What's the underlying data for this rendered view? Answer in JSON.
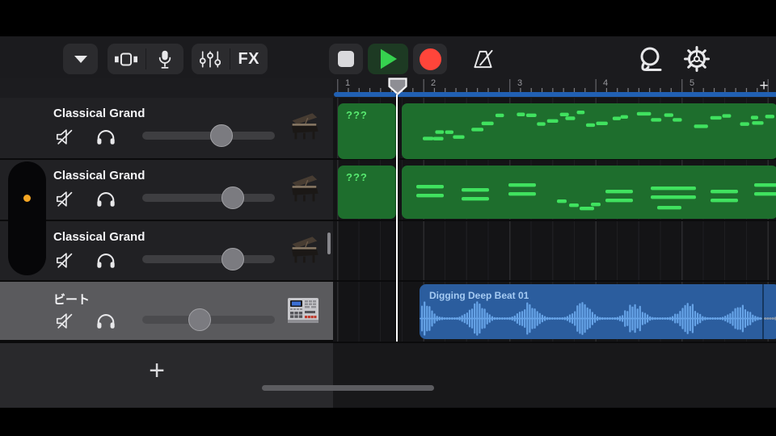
{
  "toolbar": {
    "fx_label": "FX"
  },
  "ruler": {
    "bars": [
      "1",
      "2",
      "3",
      "4",
      "5"
    ],
    "add_section_label": "+"
  },
  "tracks": [
    {
      "name": "Classical Grand",
      "instrument_icon": "grand-piano",
      "volume_percent": 60,
      "selected": false
    },
    {
      "name": "Classical Grand",
      "instrument_icon": "grand-piano",
      "volume_percent": 68,
      "selected": false
    },
    {
      "name": "Classical Grand",
      "instrument_icon": "grand-piano",
      "volume_percent": 68,
      "selected": false
    },
    {
      "name": "ビート",
      "instrument_icon": "drum-machine",
      "volume_percent": 43,
      "selected": true
    }
  ],
  "regions": {
    "track1_take": {
      "label": "???",
      "type": "midi"
    },
    "track2_take": {
      "label": "???",
      "type": "midi"
    },
    "track4_loop": {
      "label": "Digging Deep Beat 01",
      "type": "audio"
    }
  },
  "bottom": {
    "add_track_label": "+"
  },
  "colors": {
    "play_green": "#32d74b",
    "record_red": "#ff453a",
    "midi_region_green": "#1e6e2d",
    "midi_note_green": "#40e25f",
    "audio_region_blue": "#2b5d9e",
    "waveform_blue": "#67a4e8",
    "ruler_overview_blue": "#2160b2",
    "selected_track_gray": "#5a5a5d",
    "indicator_orange": "#f5a623"
  }
}
